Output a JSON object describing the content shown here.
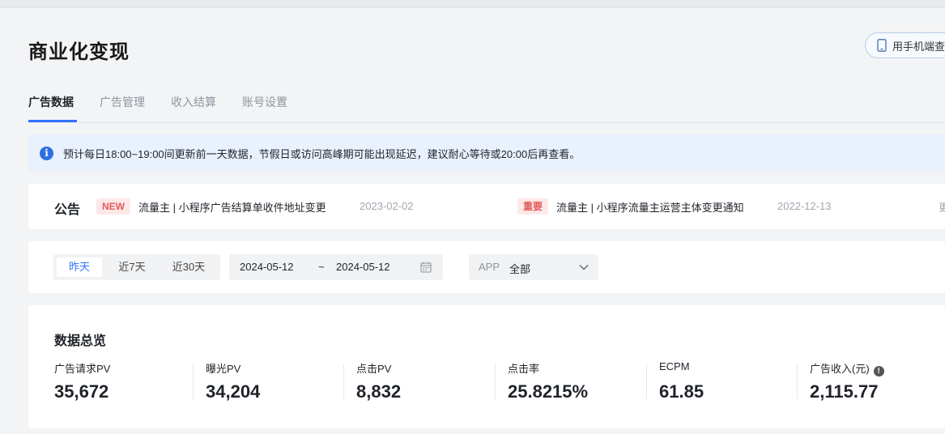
{
  "header": {
    "title": "商业化变现",
    "mobile_button_label": "用手机端查看"
  },
  "tabs": [
    {
      "label": "广告数据",
      "active": true
    },
    {
      "label": "广告管理",
      "active": false
    },
    {
      "label": "收入结算",
      "active": false
    },
    {
      "label": "账号设置",
      "active": false
    }
  ],
  "notice": {
    "icon": "info-icon",
    "text": "预计每日18:00~19:00间更新前一天数据，节假日或访问高峰期可能出现延迟，建议耐心等待或20:00后再查看。"
  },
  "announcements": {
    "title": "公告",
    "items": [
      {
        "tag": "NEW",
        "text": "流量主 | 小程序广告结算单收件地址变更",
        "date": "2023-02-02"
      },
      {
        "tag": "重要",
        "text": "流量主 | 小程序流量主运营主体变更通知",
        "date": "2022-12-13"
      }
    ],
    "more_partial": "更"
  },
  "filters": {
    "ranges": [
      {
        "label": "昨天",
        "active": true
      },
      {
        "label": "近7天",
        "active": false
      },
      {
        "label": "近30天",
        "active": false
      }
    ],
    "date_start": "2024-05-12",
    "date_sep": "~",
    "date_end": "2024-05-12",
    "app_label": "APP",
    "app_value": "全部"
  },
  "overview": {
    "title": "数据总览",
    "metrics": [
      {
        "label": "广告请求PV",
        "value": "35,672"
      },
      {
        "label": "曝光PV",
        "value": "34,204"
      },
      {
        "label": "点击PV",
        "value": "8,832"
      },
      {
        "label": "点击率",
        "value": "25.8215%"
      },
      {
        "label": "ECPM",
        "value": "61.85"
      },
      {
        "label": "广告收入(元)",
        "value": "2,115.77",
        "has_tip": true
      }
    ]
  },
  "colors": {
    "accent": "#3370ff",
    "notice_bg": "#e9f1fd",
    "tag_red": "#e25b5b"
  }
}
